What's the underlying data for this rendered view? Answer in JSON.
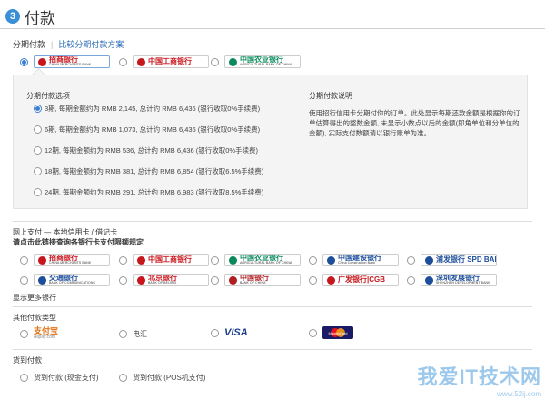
{
  "header": {
    "step": "3",
    "title": "付款"
  },
  "installment": {
    "label": "分期付款",
    "compare_link": "比较分期付款方案",
    "banks": [
      {
        "cn": "招商银行",
        "en": "CHINA MERCHANTS BANK",
        "selected": true,
        "color": "#c8161d"
      },
      {
        "cn": "中国工商银行",
        "en": "",
        "selected": false,
        "color": "#c8161d"
      },
      {
        "cn": "中国农业银行",
        "en": "AGRICULTURAL BANK OF CHINA",
        "selected": false,
        "color": "#0a8a5c"
      }
    ],
    "options_title": "分期付款选项",
    "options": [
      {
        "text": "3期, 每期金额约为 RMB 2,145, 总计约 RMB 6,436 (银行收取0%手续费)",
        "selected": true
      },
      {
        "text": "6期, 每期金额约为 RMB 1,073, 总计约 RMB 6,436 (银行收取0%手续费)",
        "selected": false
      },
      {
        "text": "12期, 每期金额约为 RMB 536, 总计约 RMB 6,436 (银行收取0%手续费)",
        "selected": false
      },
      {
        "text": "18期, 每期金额约为 RMB 381, 总计约 RMB 6,854 (银行收取6.5%手续费)",
        "selected": false
      },
      {
        "text": "24期, 每期金额约为 RMB 291, 总计约 RMB 6,983 (银行收取8.5%手续费)",
        "selected": false
      }
    ],
    "desc_title": "分期付款说明",
    "desc_text": "使用招行信用卡分期付你的订单。此处显示每期还款金额是根据你的订单估算得出的整数金额, 未显示小数点以后的金额(即角单位和分单位的金额), 实际支付数额请以银行账单为准。"
  },
  "online": {
    "label": "网上支付 — 本地信用卡 / 借记卡",
    "limit_link": "请点击此链接查询各银行卡支付限额规定",
    "banks": [
      {
        "cn": "招商银行",
        "en": "CHINA MERCHANTS BANK",
        "color": "#c8161d"
      },
      {
        "cn": "中国工商银行",
        "en": "",
        "color": "#c8161d"
      },
      {
        "cn": "中国农业银行",
        "en": "AGRICULTURAL BANK OF CHINA",
        "color": "#0a8a5c"
      },
      {
        "cn": "中国建设银行",
        "en": "China Construction Bank",
        "color": "#1d4e9c"
      },
      {
        "cn": "浦发银行 SPD BANK",
        "en": "",
        "color": "#1d4e9c"
      },
      {
        "cn": "交通银行",
        "en": "BANK OF COMMUNICATIONS",
        "color": "#1d4e9c"
      },
      {
        "cn": "北京银行",
        "en": "BANK OF BEIJING",
        "color": "#c8161d"
      },
      {
        "cn": "中国银行",
        "en": "BANK OF CHINA",
        "color": "#b01e23"
      },
      {
        "cn": "广发银行|CGB",
        "en": "",
        "color": "#c8161d"
      },
      {
        "cn": "深圳发展银行",
        "en": "SHENZHEN DEVELOPMENT BANK",
        "color": "#1d4e9c"
      }
    ],
    "more_link": "显示更多银行"
  },
  "other": {
    "label": "其他付款类型",
    "options": [
      "支付宝",
      "电汇",
      "VISA",
      "MasterCard"
    ],
    "alipay_sub": "Alipay.com"
  },
  "cod": {
    "label": "货到付款",
    "options": [
      "货到付款 (现金支付)",
      "货到付款 (POS机支付)"
    ]
  },
  "watermark": {
    "main": "我爱IT技术网",
    "sub": "www.52ij.com"
  }
}
